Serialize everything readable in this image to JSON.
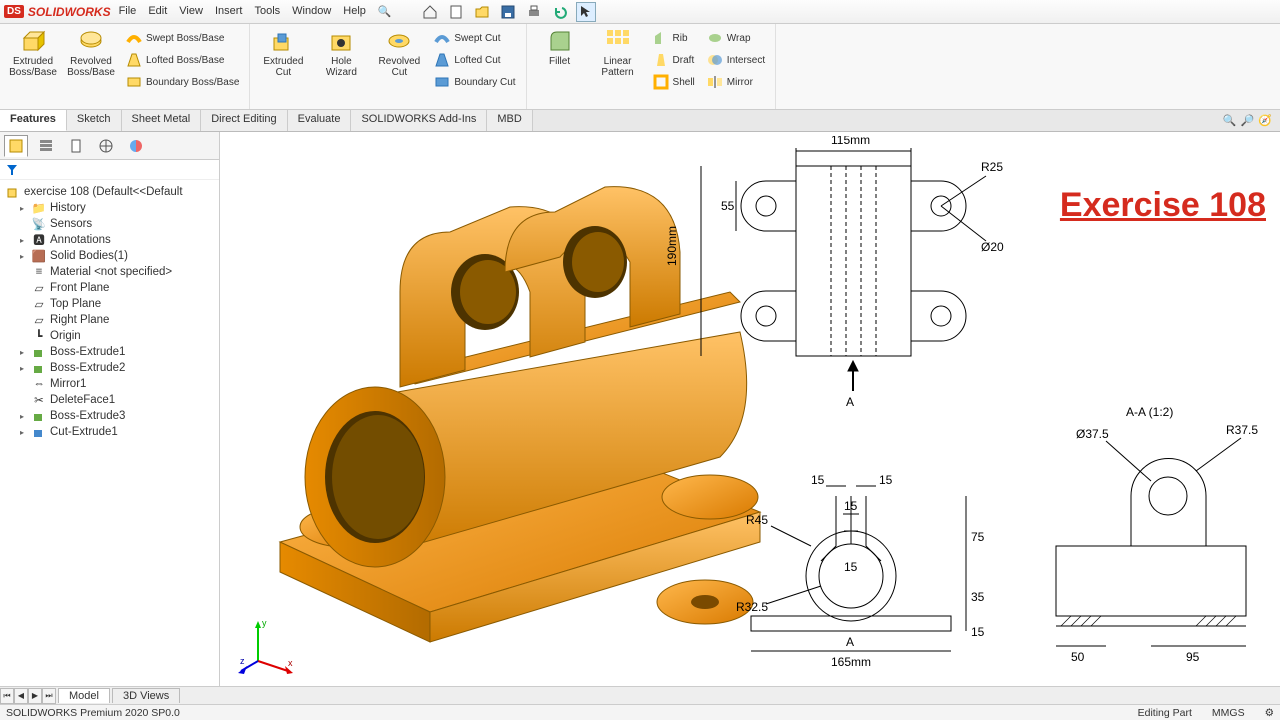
{
  "app": {
    "brand_prefix": "DS",
    "brand": "SOLIDWORKS",
    "menus": [
      "File",
      "Edit",
      "View",
      "Insert",
      "Tools",
      "Window",
      "Help"
    ]
  },
  "ribbon": {
    "extruded_boss": "Extruded Boss/Base",
    "revolved_boss": "Revolved Boss/Base",
    "swept_boss": "Swept Boss/Base",
    "lofted_boss": "Lofted Boss/Base",
    "boundary_boss": "Boundary Boss/Base",
    "extruded_cut": "Extruded Cut",
    "hole_wizard": "Hole Wizard",
    "revolved_cut": "Revolved Cut",
    "swept_cut": "Swept Cut",
    "lofted_cut": "Lofted Cut",
    "boundary_cut": "Boundary Cut",
    "fillet": "Fillet",
    "linear_pattern": "Linear Pattern",
    "rib": "Rib",
    "draft": "Draft",
    "shell": "Shell",
    "wrap": "Wrap",
    "intersect": "Intersect",
    "mirror": "Mirror"
  },
  "ribbontabs": [
    "Features",
    "Sketch",
    "Sheet Metal",
    "Direct Editing",
    "Evaluate",
    "SOLIDWORKS Add-Ins",
    "MBD"
  ],
  "tree": {
    "root": "exercise 108  (Default<<Default",
    "nodes": [
      "History",
      "Sensors",
      "Annotations",
      "Solid Bodies(1)",
      "Material <not specified>",
      "Front Plane",
      "Top Plane",
      "Right Plane",
      "Origin",
      "Boss-Extrude1",
      "Boss-Extrude2",
      "Mirror1",
      "DeleteFace1",
      "Boss-Extrude3",
      "Cut-Extrude1"
    ]
  },
  "title_overlay": "Exercise 108",
  "drawing_labels": {
    "d115": "115mm",
    "d190": "190mm",
    "d55": "55",
    "r25": "R25",
    "dia20": "Ø20",
    "aTop": "A",
    "aBottom": "A",
    "section": "A-A (1:2)",
    "dia37_5": "Ø37.5",
    "r37_5": "R37.5",
    "d15a": "15",
    "d15b": "15",
    "d15c": "15",
    "d15d": "15",
    "d15e": "15",
    "r45": "R45",
    "r32_5": "R32.5",
    "d75": "75",
    "d35": "35",
    "d165": "165mm",
    "d50": "50",
    "d95": "95"
  },
  "bottomtabs": {
    "model": "Model",
    "views3d": "3D Views"
  },
  "status": {
    "left": "SOLIDWORKS Premium 2020 SP0.0",
    "mode": "Editing Part",
    "units": "MMGS"
  },
  "triad": {
    "x": "x",
    "y": "y",
    "z": "z"
  }
}
